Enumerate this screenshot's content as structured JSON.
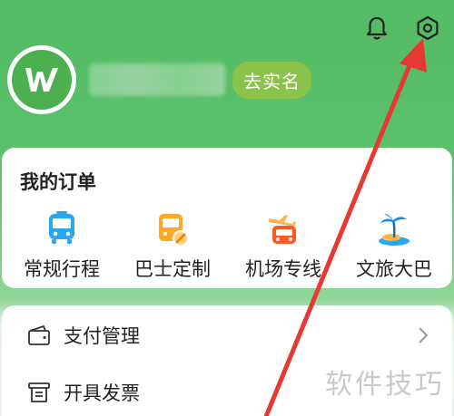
{
  "header": {
    "bell_icon": "bell-icon",
    "settings_icon": "settings-icon"
  },
  "profile": {
    "avatar_icon": "brand-logo",
    "verify_label": "去实名"
  },
  "orders": {
    "title": "我的订单",
    "items": [
      {
        "label": "常规行程",
        "icon": "bus-icon",
        "color": "#2196f3"
      },
      {
        "label": "巴士定制",
        "icon": "custom-bus-icon",
        "color": "#ff9800"
      },
      {
        "label": "机场专线",
        "icon": "airport-bus-icon",
        "color": "#ff5722"
      },
      {
        "label": "文旅大巴",
        "icon": "palm-island-icon",
        "color": "#2196f3"
      }
    ]
  },
  "menu": {
    "items": [
      {
        "label": "支付管理",
        "icon": "wallet-icon"
      },
      {
        "label": "开具发票",
        "icon": "invoice-icon"
      }
    ]
  },
  "watermark": "软件技巧",
  "colors": {
    "header_green": "#53bb63",
    "badge_green": "#8bc34a",
    "annotation_red": "#e53935"
  }
}
